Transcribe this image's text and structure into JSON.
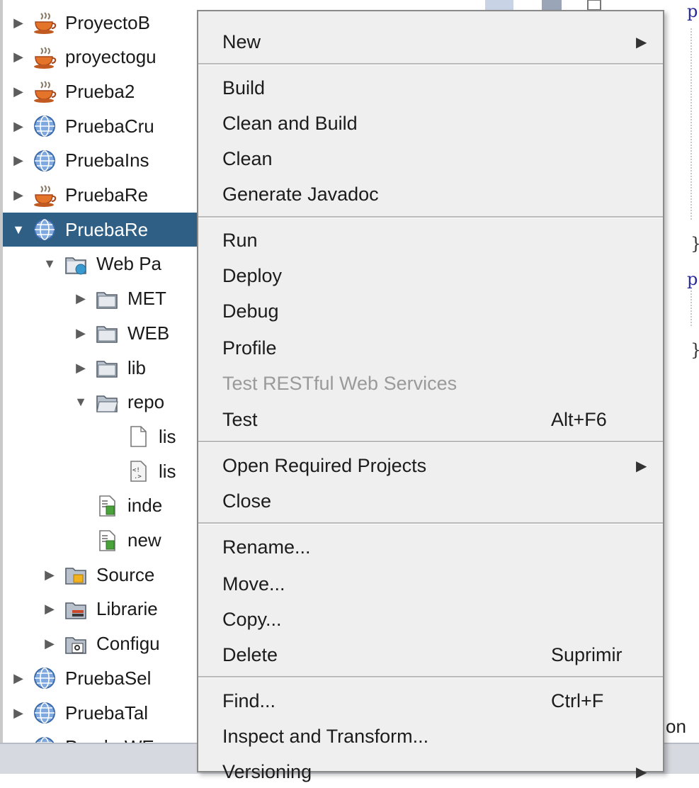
{
  "tree": {
    "items": [
      {
        "label": "ProyectoB",
        "arrow": "▶",
        "icon": "java-project-icon"
      },
      {
        "label": "proyectogu",
        "arrow": "▶",
        "icon": "java-project-icon"
      },
      {
        "label": "Prueba2",
        "arrow": "▶",
        "icon": "java-project-icon"
      },
      {
        "label": "PruebaCru",
        "arrow": "▶",
        "icon": "web-project-icon"
      },
      {
        "label": "PruebaIns",
        "arrow": "▶",
        "icon": "web-project-icon"
      },
      {
        "label": "PruebaRe",
        "arrow": "▶",
        "icon": "java-project-icon"
      },
      {
        "label": "PruebaRe",
        "arrow": "▼",
        "icon": "web-project-icon",
        "selected": true
      },
      {
        "label": "Web Pa",
        "arrow": "▼",
        "icon": "web-pages-folder-icon"
      },
      {
        "label": "MET",
        "arrow": "▶",
        "icon": "folder-icon"
      },
      {
        "label": "WEB",
        "arrow": "▶",
        "icon": "folder-icon"
      },
      {
        "label": "lib",
        "arrow": "▶",
        "icon": "folder-icon"
      },
      {
        "label": "repo",
        "arrow": "▼",
        "icon": "folder-open-icon"
      },
      {
        "label": "lis",
        "arrow": "",
        "icon": "file-icon"
      },
      {
        "label": "lis",
        "arrow": "",
        "icon": "xml-file-icon"
      },
      {
        "label": "inde",
        "arrow": "",
        "icon": "jsp-file-icon"
      },
      {
        "label": "new",
        "arrow": "",
        "icon": "jsp-file-icon"
      },
      {
        "label": "Source",
        "arrow": "▶",
        "icon": "source-packages-icon"
      },
      {
        "label": "Librarie",
        "arrow": "▶",
        "icon": "libraries-icon"
      },
      {
        "label": "Configu",
        "arrow": "▶",
        "icon": "configuration-files-icon"
      },
      {
        "label": "PruebaSel",
        "arrow": "▶",
        "icon": "web-project-icon"
      },
      {
        "label": "PruebaTal",
        "arrow": "▶",
        "icon": "web-project-icon"
      },
      {
        "label": "PruebaWE",
        "arrow": "▶",
        "icon": "web-project-icon"
      }
    ]
  },
  "menu": {
    "items": [
      {
        "label": "New",
        "submenu": "▶"
      },
      {
        "label": "Build"
      },
      {
        "label": "Clean and Build"
      },
      {
        "label": "Clean"
      },
      {
        "label": "Generate Javadoc"
      },
      {
        "label": "Run"
      },
      {
        "label": "Deploy"
      },
      {
        "label": "Debug"
      },
      {
        "label": "Profile"
      },
      {
        "label": "Test RESTful Web Services",
        "disabled": true
      },
      {
        "label": "Test",
        "shortcut": "Alt+F6"
      },
      {
        "label": "Open Required Projects",
        "submenu": "▶"
      },
      {
        "label": "Close"
      },
      {
        "label": "Rename..."
      },
      {
        "label": "Move..."
      },
      {
        "label": "Copy..."
      },
      {
        "label": "Delete",
        "shortcut": "Suprimir"
      },
      {
        "label": "Find...",
        "shortcut": "Ctrl+F"
      },
      {
        "label": "Inspect and Transform..."
      },
      {
        "label": "Versioning",
        "submenu": "▶"
      }
    ]
  },
  "editor": {
    "partial_text": "on",
    "code_chars": [
      "p",
      "}",
      "p",
      "}"
    ]
  },
  "colors": {
    "selection": "#2f5f85",
    "menu_bg": "#efefef",
    "code_keyword": "#2a2a9a"
  }
}
